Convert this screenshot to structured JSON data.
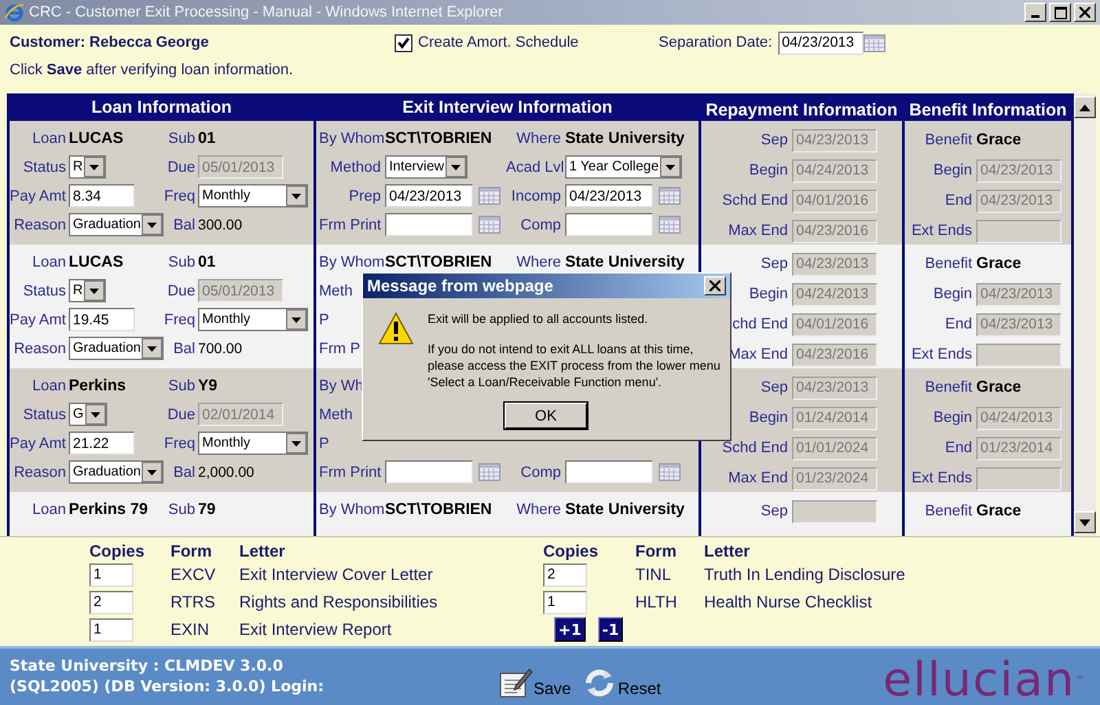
{
  "window": {
    "title": "CRC - Customer Exit Processing - Manual - Windows Internet Explorer"
  },
  "header": {
    "customer": "Customer: Rebecca George",
    "amort": {
      "label": "Create Amort. Schedule",
      "checked": true
    },
    "separation": {
      "label": "Separation Date:",
      "value": "04/23/2013"
    },
    "hint": "Click **Save** after verifying loan information."
  },
  "grid": {
    "columns": [
      "Loan Information",
      "Exit Interview Information",
      "Repayment Information",
      "Benefit Information"
    ],
    "rows": [
      {
        "loan": [
          [
            {
              "label": "Loan",
              "kind": "strong",
              "value": "LUCAS"
            },
            {
              "label": "Sub",
              "kind": "strong",
              "value": "01"
            }
          ],
          [
            {
              "label": "Status",
              "kind": "select",
              "value": "R"
            },
            {
              "label": "Due",
              "kind": "readonly",
              "value": "05/01/2013"
            }
          ],
          [
            {
              "label": "Pay Amt",
              "kind": "input",
              "value": "8.34"
            },
            {
              "label": "Freq",
              "kind": "select",
              "value": "Monthly"
            }
          ],
          [
            {
              "label": "Reason",
              "kind": "select",
              "value": "Graduation"
            },
            {
              "label": "Bal",
              "kind": "plain",
              "value": "300.00"
            }
          ]
        ],
        "exit": [
          [
            {
              "label": "By Whom",
              "kind": "strong",
              "value": "SCT\\TOBRIEN"
            },
            {
              "label": "Where",
              "kind": "strong",
              "value": "State University"
            }
          ],
          [
            {
              "label": "Method",
              "kind": "select",
              "value": "Interview"
            },
            {
              "label": "Acad Lvl",
              "kind": "select",
              "value": "1 Year College"
            }
          ],
          [
            {
              "label": "Prep",
              "kind": "date",
              "value": "04/23/2013"
            },
            {
              "label": "Incomp",
              "kind": "date",
              "value": "04/23/2013"
            }
          ],
          [
            {
              "label": "Frm Print",
              "kind": "date"
            },
            {
              "label": "Comp",
              "kind": "date"
            }
          ]
        ],
        "repay": [
          {
            "label": "Sep",
            "kind": "readonly",
            "value": "04/23/2013"
          },
          {
            "label": "Begin",
            "kind": "readonly",
            "value": "04/24/2013"
          },
          {
            "label": "Schd End",
            "kind": "readonly",
            "value": "04/01/2016"
          },
          {
            "label": "Max End",
            "kind": "readonly",
            "value": "04/23/2016"
          }
        ],
        "benefit": [
          {
            "label": "Benefit",
            "kind": "strong",
            "value": "Grace"
          },
          {
            "label": "Begin",
            "kind": "readonly",
            "value": "04/23/2013"
          },
          {
            "label": "End",
            "kind": "readonly",
            "value": "04/23/2013"
          },
          {
            "label": "Ext Ends",
            "kind": "readonly"
          }
        ]
      },
      {
        "loan": [
          [
            {
              "label": "Loan",
              "kind": "strong",
              "value": "LUCAS"
            },
            {
              "label": "Sub",
              "kind": "strong",
              "value": "01"
            }
          ],
          [
            {
              "label": "Status",
              "kind": "select",
              "value": "R"
            },
            {
              "label": "Due",
              "kind": "readonly",
              "value": "05/01/2013"
            }
          ],
          [
            {
              "label": "Pay Amt",
              "kind": "input",
              "value": "19.45"
            },
            {
              "label": "Freq",
              "kind": "select",
              "value": "Monthly"
            }
          ],
          [
            {
              "label": "Reason",
              "kind": "select",
              "value": "Graduation"
            },
            {
              "label": "Bal",
              "kind": "plain",
              "value": "700.00"
            }
          ]
        ],
        "exit": [
          [
            {
              "label": "By Whom",
              "kind": "strong",
              "value": "SCT\\TOBRIEN"
            },
            {
              "label": "Where",
              "kind": "strong",
              "value": "State University"
            }
          ],
          [
            {
              "label": "Meth",
              "kind": "cut"
            }
          ],
          [
            {
              "label": "P",
              "kind": "cut"
            }
          ],
          [
            {
              "label": "Frm P",
              "kind": "cut"
            }
          ]
        ],
        "repay": [
          {
            "label": "Sep",
            "kind": "readonly",
            "value": "04/23/2013"
          },
          {
            "label": "Begin",
            "kind": "readonly",
            "value": "04/24/2013"
          },
          {
            "label": "chd End",
            "kind": "readonly",
            "value": "04/01/2016"
          },
          {
            "label": "Max End",
            "kind": "readonly",
            "value": "04/23/2016"
          }
        ],
        "benefit": [
          {
            "label": "Benefit",
            "kind": "strong",
            "value": "Grace"
          },
          {
            "label": "Begin",
            "kind": "readonly",
            "value": "04/23/2013"
          },
          {
            "label": "End",
            "kind": "readonly",
            "value": "04/23/2013"
          },
          {
            "label": "Ext Ends",
            "kind": "readonly"
          }
        ]
      },
      {
        "loan": [
          [
            {
              "label": "Loan",
              "kind": "strong",
              "value": "Perkins"
            },
            {
              "label": "Sub",
              "kind": "strong",
              "value": "Y9"
            }
          ],
          [
            {
              "label": "Status",
              "kind": "select",
              "value": "G"
            },
            {
              "label": "Due",
              "kind": "readonly",
              "value": "02/01/2014"
            }
          ],
          [
            {
              "label": "Pay Amt",
              "kind": "input",
              "value": "21.22"
            },
            {
              "label": "Freq",
              "kind": "select",
              "value": "Monthly"
            }
          ],
          [
            {
              "label": "Reason",
              "kind": "select",
              "value": "Graduation"
            },
            {
              "label": "Bal",
              "kind": "plain",
              "value": "2,000.00"
            }
          ]
        ],
        "exit": [
          [
            {
              "label": "By Wh",
              "kind": "cut"
            }
          ],
          [
            {
              "label": "Meth",
              "kind": "cut"
            }
          ],
          [
            {
              "label": "P",
              "kind": "cut"
            }
          ],
          [
            {
              "label": "Frm Print",
              "kind": "date"
            },
            {
              "label": "Comp",
              "kind": "date"
            }
          ]
        ],
        "repay": [
          {
            "label": "Sep",
            "kind": "readonly",
            "value": "04/23/2013"
          },
          {
            "label": "Begin",
            "kind": "readonly",
            "value": "01/24/2014"
          },
          {
            "label": "Schd End",
            "kind": "readonly",
            "value": "01/01/2024"
          },
          {
            "label": "Max End",
            "kind": "readonly",
            "value": "01/23/2024"
          }
        ],
        "benefit": [
          {
            "label": "Benefit",
            "kind": "strong",
            "value": "Grace"
          },
          {
            "label": "Begin",
            "kind": "readonly",
            "value": "04/24/2013"
          },
          {
            "label": "End",
            "kind": "readonly",
            "value": "01/23/2014"
          },
          {
            "label": "Ext Ends",
            "kind": "readonly"
          }
        ]
      },
      {
        "loan": [
          [
            {
              "label": "Loan",
              "kind": "strong",
              "value": "Perkins 79"
            },
            {
              "label": "Sub",
              "kind": "strong",
              "value": "79"
            }
          ]
        ],
        "exit": [
          [
            {
              "label": "By Whom",
              "kind": "strong",
              "value": "SCT\\TOBRIEN"
            },
            {
              "label": "Where",
              "kind": "strong",
              "value": "State University"
            }
          ]
        ],
        "repay": [
          {
            "label": "Sep",
            "kind": "readonly"
          }
        ],
        "benefit": [
          {
            "label": "Benefit",
            "kind": "strong",
            "value": "Grace"
          }
        ]
      }
    ]
  },
  "letters": {
    "headers": [
      "Copies",
      "Form",
      "Letter"
    ],
    "left": [
      {
        "copies": "1",
        "form": "EXCV",
        "letter": "Exit Interview Cover Letter"
      },
      {
        "copies": "2",
        "form": "RTRS",
        "letter": "Rights and Responsibilities"
      },
      {
        "copies": "1",
        "form": "EXIN",
        "letter": "Exit Interview Report"
      }
    ],
    "right_headers": [
      "Copies",
      "Form",
      "Letter"
    ],
    "right": [
      {
        "copies": "2",
        "form": "TINL",
        "letter": "Truth In Lending Disclosure"
      },
      {
        "copies": "1",
        "form": "HLTH",
        "letter": "Health Nurse Checklist"
      }
    ],
    "buttons": [
      "+1",
      "-1"
    ]
  },
  "footer": {
    "info": [
      "State University : CLMDEV 3.0.0",
      "(SQL2005) (DB Version: 3.0.0) Login:"
    ],
    "actions": [
      "Save",
      "Reset"
    ],
    "logo": "ellucian$^{™}$"
  },
  "dialog": {
    "title": "Message from webpage",
    "message": "Exit will be applied to all accounts listed.",
    "detail": "If you do not intend to exit ALL loans at this time,\nplease access the EXIT process from the lower menu\n'Select a Loan/Receivable Function menu'.",
    "button": "OK"
  }
}
